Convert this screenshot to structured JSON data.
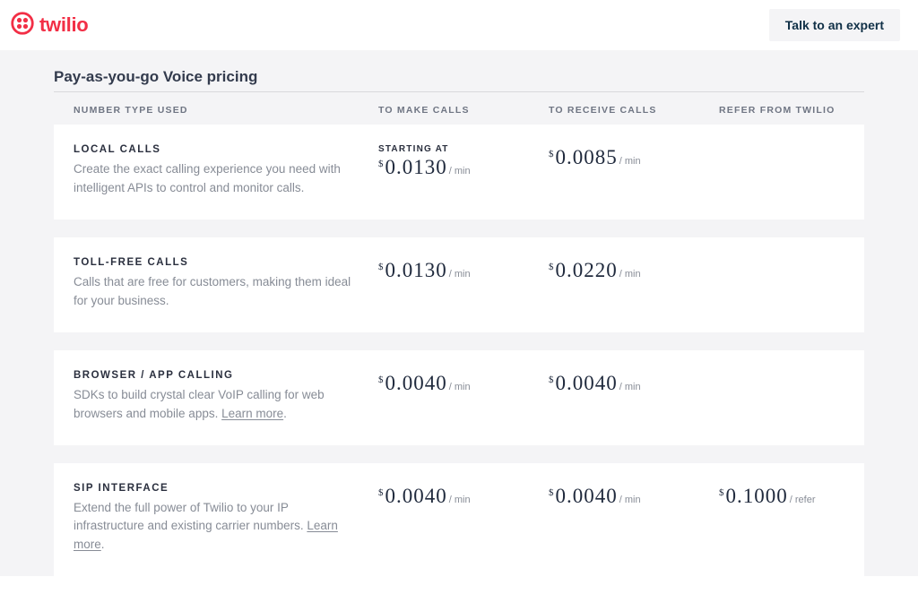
{
  "header": {
    "brand": "twilio",
    "talk_to_expert": "Talk to an expert"
  },
  "pricing": {
    "title": "Pay-as-you-go Voice pricing",
    "columns": {
      "type": "NUMBER TYPE USED",
      "make": "TO MAKE CALLS",
      "receive": "TO RECEIVE CALLS",
      "refer": "REFER FROM TWILIO"
    },
    "starting_at": "STARTING AT",
    "per_min": "/ min",
    "per_refer": "/ refer",
    "learn_more": "Learn more",
    "rows": [
      {
        "title": "LOCAL CALLS",
        "desc": "Create the exact calling experience you need with intelligent APIs to control and monitor calls.",
        "make": "0.0130",
        "receive": "0.0085",
        "refer": "",
        "starting": true,
        "learn_more": false
      },
      {
        "title": "TOLL-FREE CALLS",
        "desc": "Calls that are free for customers, making them ideal for your business.",
        "make": "0.0130",
        "receive": "0.0220",
        "refer": "",
        "starting": false,
        "learn_more": false
      },
      {
        "title": "BROWSER / APP CALLING",
        "desc": "SDKs to build crystal clear VoIP calling for web browsers and mobile apps. ",
        "make": "0.0040",
        "receive": "0.0040",
        "refer": "",
        "starting": false,
        "learn_more": true
      },
      {
        "title": "SIP INTERFACE",
        "desc": "Extend the full power of Twilio to your IP infrastructure and existing carrier numbers. ",
        "make": "0.0040",
        "receive": "0.0040",
        "refer": "0.1000",
        "starting": false,
        "learn_more": true
      }
    ]
  }
}
